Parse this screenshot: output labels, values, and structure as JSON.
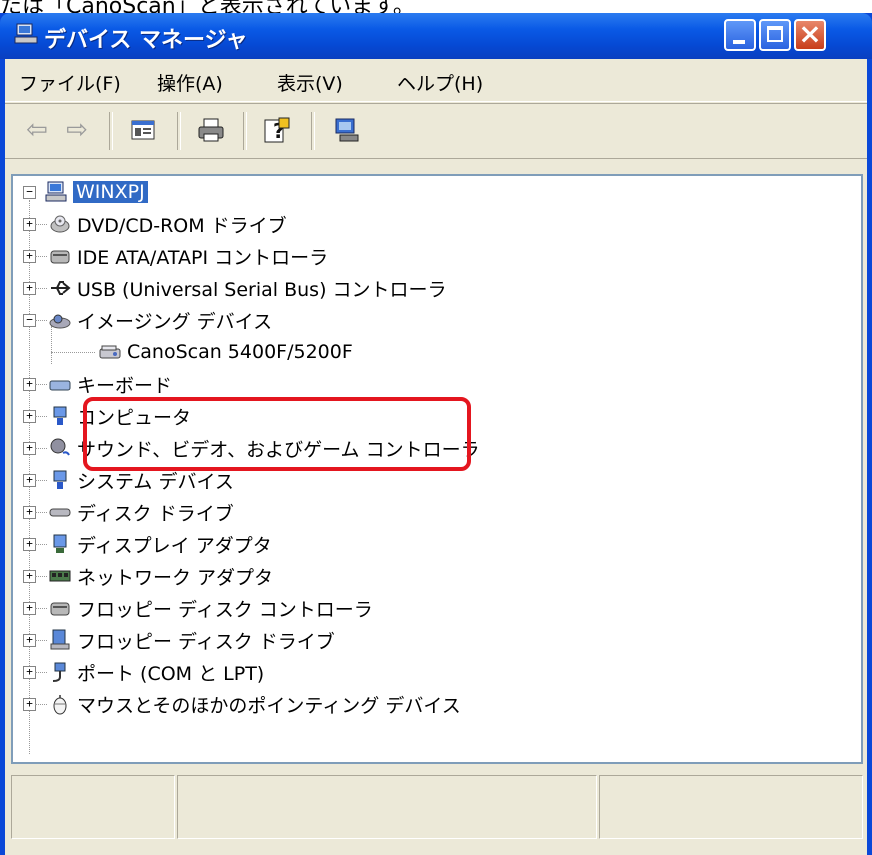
{
  "caption": "たは「CanoScan」と表示されています。",
  "window": {
    "title": "デバイス マネージャ",
    "controls": {
      "minimize": "",
      "maximize": "",
      "close": "×"
    }
  },
  "menu": [
    "ファイル(F)",
    "操作(A)",
    "表示(V)",
    "ヘルプ(H)"
  ],
  "toolbar": {
    "buttons": [
      "back-icon",
      "forward-icon",
      "properties-icon",
      "print-icon",
      "help-icon",
      "scan-hardware-icon"
    ],
    "glyphs": {
      "back": "⇦",
      "forward": "⇨"
    }
  },
  "tree": {
    "root": {
      "label": "WINXPJ",
      "expander": "−"
    },
    "items": [
      {
        "label": "DVD/CD-ROM ドライブ",
        "expander": "+"
      },
      {
        "label": "IDE ATA/ATAPI コントローラ",
        "expander": "+"
      },
      {
        "label": "USB (Universal Serial Bus) コントローラ",
        "expander": "+"
      },
      {
        "label": "イメージング デバイス",
        "expander": "−"
      },
      {
        "label": "キーボード",
        "expander": "+"
      },
      {
        "label": "コンピュータ",
        "expander": "+"
      },
      {
        "label": "サウンド、ビデオ、およびゲーム コントローラ",
        "expander": "+"
      },
      {
        "label": "システム デバイス",
        "expander": "+"
      },
      {
        "label": "ディスク ドライブ",
        "expander": "+"
      },
      {
        "label": "ディスプレイ アダプタ",
        "expander": "+"
      },
      {
        "label": "ネットワーク アダプタ",
        "expander": "+"
      },
      {
        "label": "フロッピー ディスク コントローラ",
        "expander": "+"
      },
      {
        "label": "フロッピー ディスク ドライブ",
        "expander": "+"
      },
      {
        "label": "ポート (COM と LPT)",
        "expander": "+"
      },
      {
        "label": "マウスとそのほかのポインティング デバイス",
        "expander": "+"
      }
    ],
    "child": {
      "label": "CanoScan 5400F/5200F"
    }
  },
  "colors": {
    "highlight_border": "#e4161f",
    "selection": "#316ac5",
    "titlebar": "#0a5ae6"
  }
}
